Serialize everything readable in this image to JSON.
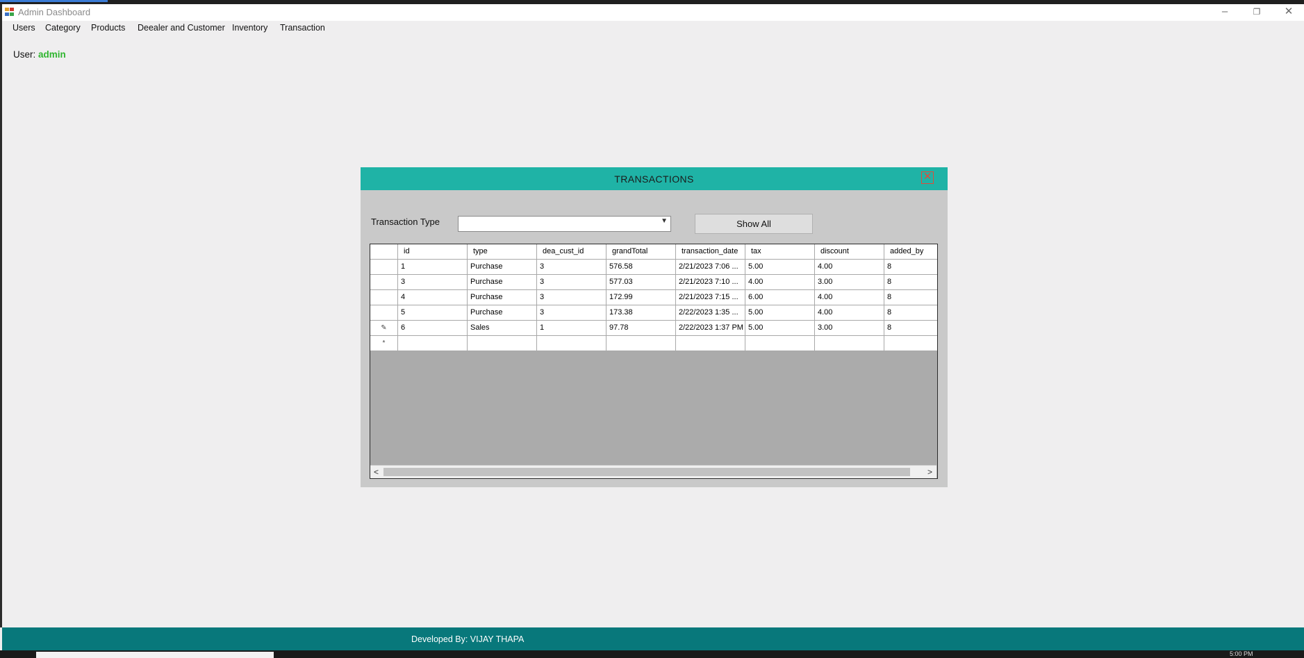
{
  "window": {
    "title": "Admin Dashboard",
    "minimize_glyph": "–",
    "restore_glyph": "❐",
    "close_glyph": "✕"
  },
  "menu": {
    "items": [
      "Users",
      "Category",
      "Products",
      "Deealer and Customer",
      "Inventory",
      "Transaction"
    ]
  },
  "user": {
    "label": "User:",
    "name": "admin"
  },
  "dialog": {
    "title": "TRANSACTIONS",
    "close_glyph": "✕",
    "transaction_type_label": "Transaction Type",
    "transaction_type_value": "",
    "show_all_label": "Show All"
  },
  "grid": {
    "columns": [
      "id",
      "type",
      "dea_cust_id",
      "grandTotal",
      "transaction_date",
      "tax",
      "discount",
      "added_by"
    ],
    "rows": [
      [
        "1",
        "Purchase",
        "3",
        "576.58",
        "2/21/2023 7:06 ...",
        "5.00",
        "4.00",
        "8"
      ],
      [
        "3",
        "Purchase",
        "3",
        "577.03",
        "2/21/2023 7:10 ...",
        "4.00",
        "3.00",
        "8"
      ],
      [
        "4",
        "Purchase",
        "3",
        "172.99",
        "2/21/2023 7:15 ...",
        "6.00",
        "4.00",
        "8"
      ],
      [
        "5",
        "Purchase",
        "3",
        "173.38",
        "2/22/2023 1:35 ...",
        "5.00",
        "4.00",
        "8"
      ],
      [
        "6",
        "Sales",
        "1",
        "97.78",
        "2/22/2023 1:37 PM",
        "5.00",
        "3.00",
        "8"
      ]
    ],
    "editing_row_marker": "✎",
    "new_row_marker": "*",
    "scroll_left": "<",
    "scroll_right": ">"
  },
  "footer": {
    "text": "Developed By: VIJAY THAPA"
  },
  "taskbar": {
    "clock": "5:00 PM"
  },
  "colors": {
    "dialog_header": "#1fb3a6",
    "footer": "#08787b",
    "username": "#2fb52f",
    "close_border": "#e04b3a"
  },
  "icons": {
    "app": "app-grid-icon",
    "dropdown": "chevron-down-icon",
    "close": "close-icon"
  }
}
